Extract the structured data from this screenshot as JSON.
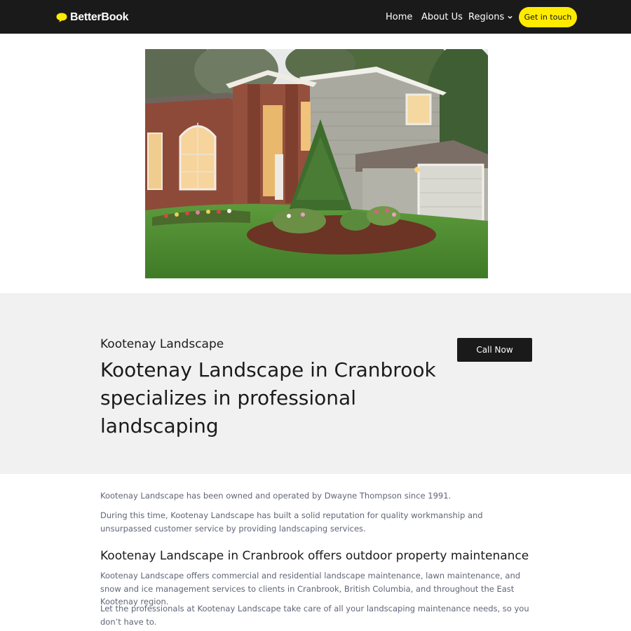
{
  "header": {
    "logo_text": "BetterBook",
    "nav": {
      "home": "Home",
      "about": "About Us",
      "regions": "Regions"
    },
    "cta_label": "Get in touch",
    "colors": {
      "bar": "#1a1a1a",
      "accent": "#ffeb00"
    }
  },
  "hero": {
    "company": "Kootenay Landscape",
    "headline": "Kootenay Landscape in Cranbrook specializes in professional landscaping",
    "call_label": "Call Now"
  },
  "content": {
    "p1": "Kootenay Landscape has been owned and operated by Dwayne Thompson since 1991.",
    "p2": "During this time, Kootenay Landscape has built a solid reputation for quality workmanship and unsurpassed customer service by providing landscaping services.",
    "subheading": "Kootenay Landscape in Cranbrook offers outdoor property maintenance",
    "p3": "Kootenay Landscape offers commercial and residential landscape maintenance, lawn maintenance, and snow and ice management services to clients in Cranbrook, British Columbia, and throughout the East Kootenay region.",
    "p4": "Let the professionals at Kootenay Landscape take care of all your landscaping maintenance needs, so you don’t have to."
  },
  "icons": {
    "logo": "speech-bubble-icon",
    "regions_dropdown": "chevron-down-icon"
  }
}
